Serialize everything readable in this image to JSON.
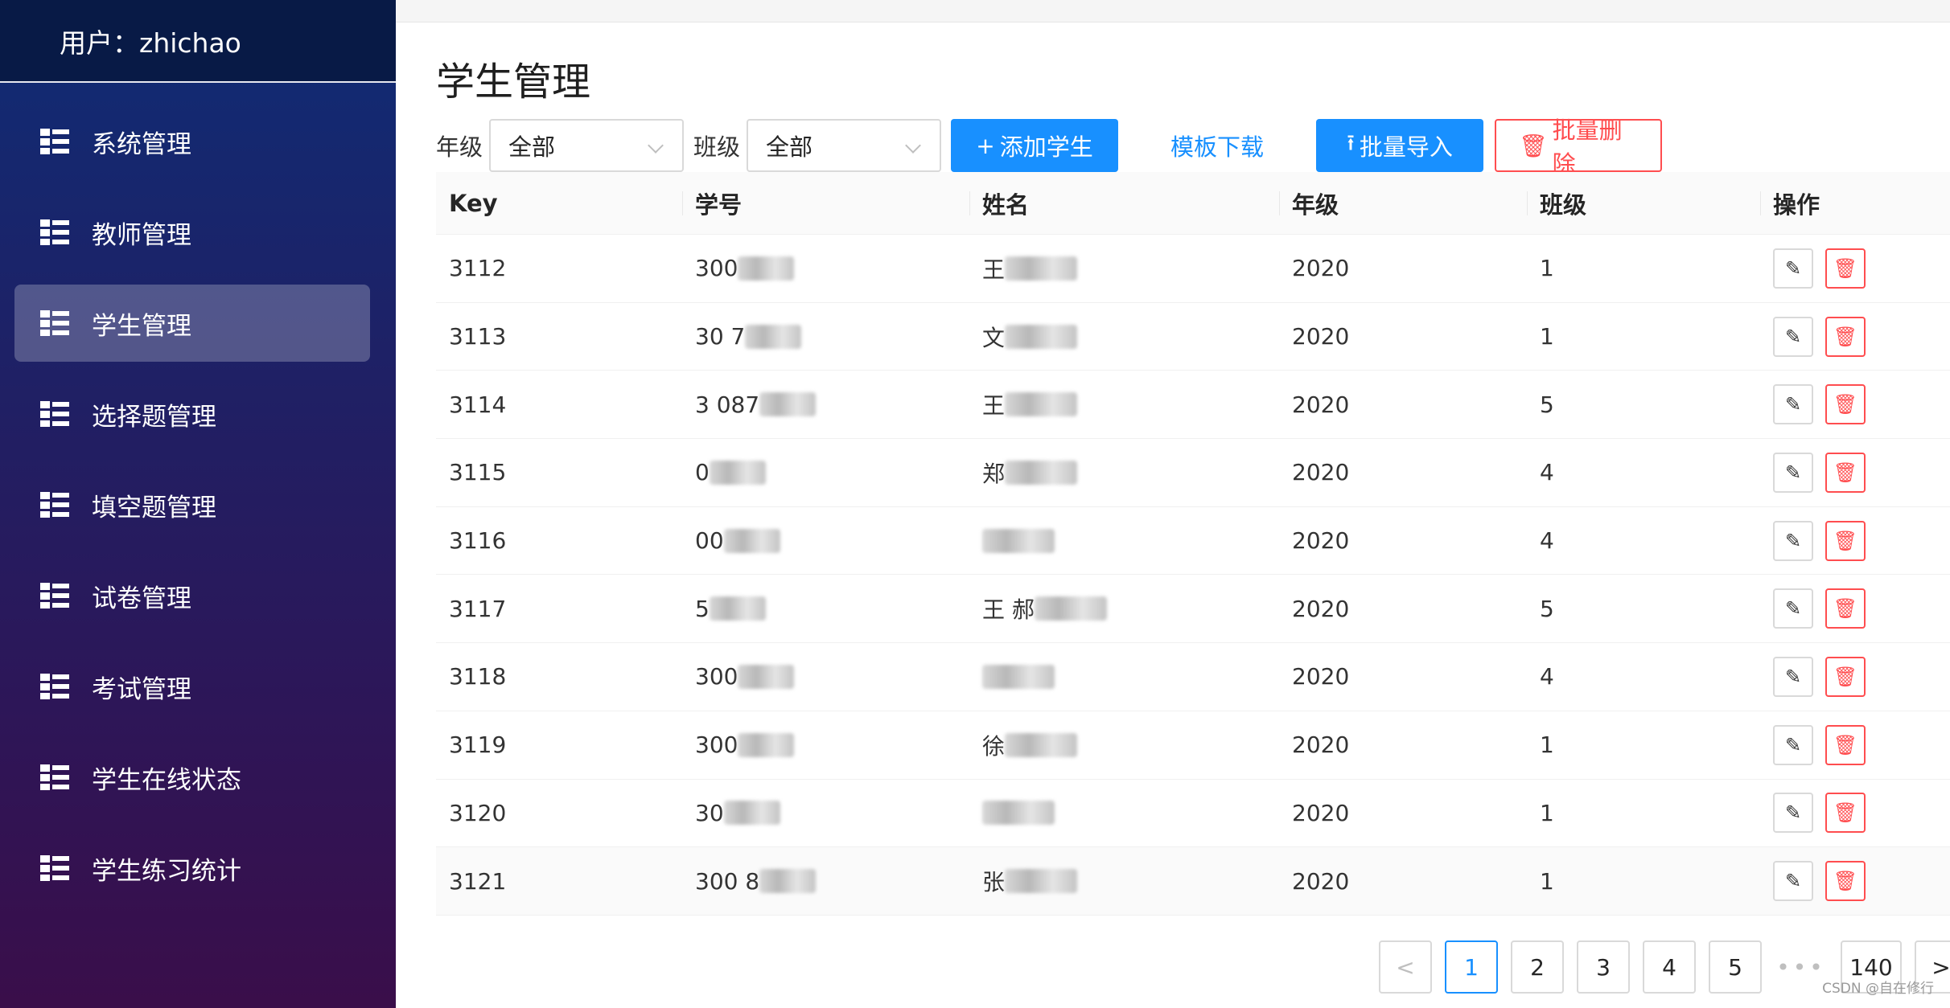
{
  "sidebar": {
    "user_label": "用户：zhichao",
    "items": [
      {
        "label": "系统管理",
        "active": false
      },
      {
        "label": "教师管理",
        "active": false
      },
      {
        "label": "学生管理",
        "active": true
      },
      {
        "label": "选择题管理",
        "active": false
      },
      {
        "label": "填空题管理",
        "active": false
      },
      {
        "label": "试卷管理",
        "active": false
      },
      {
        "label": "考试管理",
        "active": false
      },
      {
        "label": "学生在线状态",
        "active": false
      },
      {
        "label": "学生练习统计",
        "active": false
      }
    ]
  },
  "main": {
    "title": "学生管理",
    "filters": {
      "grade_label": "年级",
      "grade_value": "全部",
      "class_label": "班级",
      "class_value": "全部"
    },
    "buttons": {
      "add": "添加学生",
      "template": "模板下载",
      "import": "批量导入",
      "batch_delete": "批量删除"
    },
    "table": {
      "headers": [
        "Key",
        "学号",
        "姓名",
        "年级",
        "班级",
        "操作"
      ],
      "rows": [
        {
          "key": "3112",
          "no": "300",
          "name": "王",
          "grade": "2020",
          "class": "1"
        },
        {
          "key": "3113",
          "no": "30  7",
          "name": "文",
          "grade": "2020",
          "class": "1"
        },
        {
          "key": "3114",
          "no": "3 087",
          "name": "王",
          "grade": "2020",
          "class": "5"
        },
        {
          "key": "3115",
          "no": "0",
          "name": "郑",
          "grade": "2020",
          "class": "4"
        },
        {
          "key": "3116",
          "no": "00",
          "name": "",
          "grade": "2020",
          "class": "4"
        },
        {
          "key": "3117",
          "no": "5",
          "name": "王 郝",
          "grade": "2020",
          "class": "5"
        },
        {
          "key": "3118",
          "no": "300",
          "name": "",
          "grade": "2020",
          "class": "4"
        },
        {
          "key": "3119",
          "no": "300",
          "name": "徐",
          "grade": "2020",
          "class": "1"
        },
        {
          "key": "3120",
          "no": "30",
          "name": "",
          "grade": "2020",
          "class": "1"
        },
        {
          "key": "3121",
          "no": "300 8",
          "name": "张",
          "grade": "2020",
          "class": "1"
        }
      ]
    },
    "pagination": {
      "prev": "<",
      "pages": [
        "1",
        "2",
        "3",
        "4",
        "5"
      ],
      "ellipsis": "•••",
      "last": "140",
      "next": ">",
      "current": "1"
    }
  },
  "watermark": "CSDN @自在修行",
  "colors": {
    "primary": "#1890ff",
    "danger": "#ff4d4f",
    "sidebar_top": "#0f2c75",
    "sidebar_bottom": "#3a0e4a"
  }
}
